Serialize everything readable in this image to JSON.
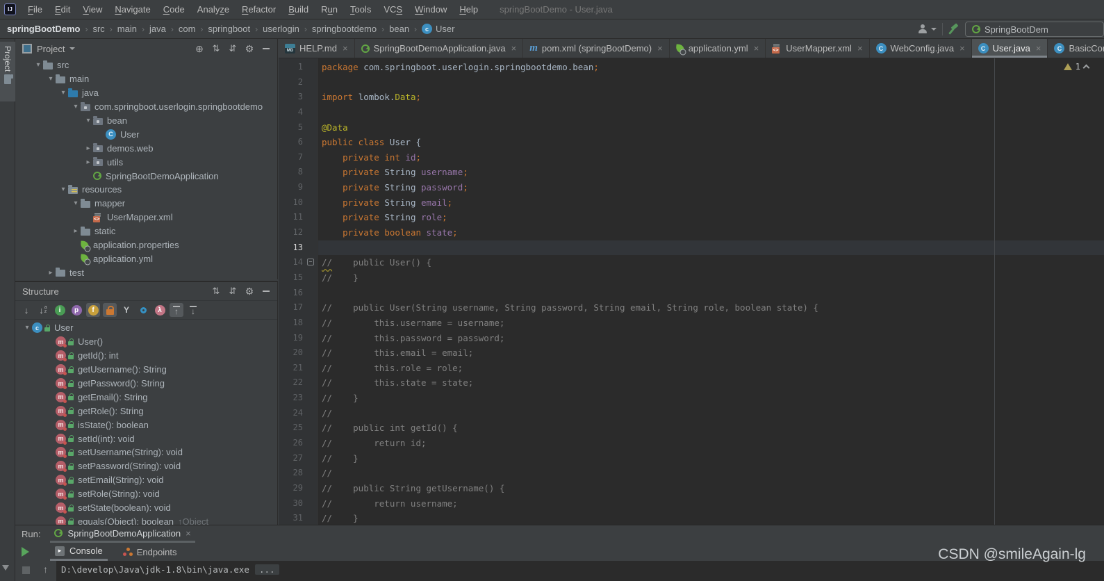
{
  "window": {
    "title": "springBootDemo - User.java",
    "menu": [
      {
        "label": "File",
        "u": 0
      },
      {
        "label": "Edit",
        "u": 0
      },
      {
        "label": "View",
        "u": 0
      },
      {
        "label": "Navigate",
        "u": 0
      },
      {
        "label": "Code",
        "u": 0
      },
      {
        "label": "Analyze",
        "u": 5
      },
      {
        "label": "Refactor",
        "u": 0
      },
      {
        "label": "Build",
        "u": 0
      },
      {
        "label": "Run",
        "u": 1
      },
      {
        "label": "Tools",
        "u": 0
      },
      {
        "label": "VCS",
        "u": 2
      },
      {
        "label": "Window",
        "u": 0
      },
      {
        "label": "Help",
        "u": 0
      }
    ]
  },
  "breadcrumbs": {
    "items": [
      "springBootDemo",
      "src",
      "main",
      "java",
      "com",
      "springboot",
      "userlogin",
      "springbootdemo",
      "bean"
    ],
    "current": {
      "label": "User",
      "icon": "class"
    },
    "run_config": "SpringBootDem"
  },
  "project_panel": {
    "title": "Project",
    "header_icons": [
      "locate",
      "expand-all",
      "collapse-all",
      "settings",
      "hide"
    ],
    "tree": [
      {
        "label": "src",
        "icon": "folder",
        "level": 1,
        "chevron": "open"
      },
      {
        "label": "main",
        "icon": "folder",
        "level": 2,
        "chevron": "open"
      },
      {
        "label": "java",
        "icon": "folder-source",
        "level": 3,
        "chevron": "open"
      },
      {
        "label": "com.springboot.userlogin.springbootdemo",
        "icon": "package",
        "level": 4,
        "chevron": "open"
      },
      {
        "label": "bean",
        "icon": "package",
        "level": 5,
        "chevron": "open"
      },
      {
        "label": "User",
        "icon": "class",
        "letter": "C",
        "level": 6,
        "chevron": "none"
      },
      {
        "label": "demos.web",
        "icon": "package",
        "level": 5,
        "chevron": "closed"
      },
      {
        "label": "utils",
        "icon": "package",
        "level": 5,
        "chevron": "closed"
      },
      {
        "label": "SpringBootDemoApplication",
        "icon": "springboot-class",
        "level": 5,
        "chevron": "none"
      },
      {
        "label": "resources",
        "icon": "folder-resources",
        "level": 3,
        "chevron": "open"
      },
      {
        "label": "mapper",
        "icon": "folder",
        "level": 4,
        "chevron": "open"
      },
      {
        "label": "UserMapper.xml",
        "icon": "xml-file",
        "level": 5,
        "chevron": "none"
      },
      {
        "label": "static",
        "icon": "folder",
        "level": 4,
        "chevron": "closed"
      },
      {
        "label": "application.properties",
        "icon": "spring-file",
        "level": 4,
        "chevron": "none"
      },
      {
        "label": "application.yml",
        "icon": "spring-file",
        "level": 4,
        "chevron": "none"
      },
      {
        "label": "test",
        "icon": "folder",
        "level": 2,
        "chevron": "closed"
      }
    ]
  },
  "structure_panel": {
    "title": "Structure",
    "header_icons": [
      "expand-all",
      "collapse-all",
      "settings",
      "hide"
    ],
    "toolbar": [
      {
        "icon": "sort-visibility",
        "selected": false
      },
      {
        "icon": "sort-alpha",
        "selected": false
      },
      {
        "icon": "inherited",
        "letter": "i",
        "color": "#499C54",
        "selected": false
      },
      {
        "icon": "properties",
        "letter": "p",
        "color": "#8e67ab",
        "selected": false
      },
      {
        "icon": "fields",
        "letter": "f",
        "color": "#c8a03c",
        "selected": true
      },
      {
        "icon": "nonpublic",
        "selected": true
      },
      {
        "icon": "anonymous",
        "letter": "Y",
        "selected": false
      },
      {
        "icon": "ring",
        "selected": false
      },
      {
        "icon": "lambda",
        "letter": "λ",
        "color": "#c27585",
        "selected": false
      },
      {
        "icon": "scroll-to-source",
        "selected": true
      },
      {
        "icon": "scroll-from-source",
        "selected": false
      }
    ],
    "tree": [
      {
        "label": "User",
        "icon": "class",
        "letter": "c",
        "lock": true,
        "level": 0,
        "chevron": "open",
        "suffix": ""
      },
      {
        "label": "User()",
        "icon": "method",
        "letter": "m",
        "lock": true,
        "level": 1,
        "chevron": "none",
        "suffix": ""
      },
      {
        "label": "getId(): int",
        "icon": "method",
        "letter": "m",
        "lock": true,
        "level": 1,
        "chevron": "none",
        "suffix": ""
      },
      {
        "label": "getUsername(): String",
        "icon": "method",
        "letter": "m",
        "lock": true,
        "level": 1,
        "chevron": "none",
        "suffix": ""
      },
      {
        "label": "getPassword(): String",
        "icon": "method",
        "letter": "m",
        "lock": true,
        "level": 1,
        "chevron": "none",
        "suffix": ""
      },
      {
        "label": "getEmail(): String",
        "icon": "method",
        "letter": "m",
        "lock": true,
        "level": 1,
        "chevron": "none",
        "suffix": ""
      },
      {
        "label": "getRole(): String",
        "icon": "method",
        "letter": "m",
        "lock": true,
        "level": 1,
        "chevron": "none",
        "suffix": ""
      },
      {
        "label": "isState(): boolean",
        "icon": "method",
        "letter": "m",
        "lock": true,
        "level": 1,
        "chevron": "none",
        "suffix": ""
      },
      {
        "label": "setId(int): void",
        "icon": "method",
        "letter": "m",
        "lock": true,
        "level": 1,
        "chevron": "none",
        "suffix": ""
      },
      {
        "label": "setUsername(String): void",
        "icon": "method",
        "letter": "m",
        "lock": true,
        "level": 1,
        "chevron": "none",
        "suffix": ""
      },
      {
        "label": "setPassword(String): void",
        "icon": "method",
        "letter": "m",
        "lock": true,
        "level": 1,
        "chevron": "none",
        "suffix": ""
      },
      {
        "label": "setEmail(String): void",
        "icon": "method",
        "letter": "m",
        "lock": true,
        "level": 1,
        "chevron": "none",
        "suffix": ""
      },
      {
        "label": "setRole(String): void",
        "icon": "method",
        "letter": "m",
        "lock": true,
        "level": 1,
        "chevron": "none",
        "suffix": ""
      },
      {
        "label": "setState(boolean): void",
        "icon": "method",
        "letter": "m",
        "lock": true,
        "level": 1,
        "chevron": "none",
        "suffix": ""
      },
      {
        "label": "equals(Object): boolean",
        "icon": "method",
        "letter": "m",
        "lock": true,
        "level": 1,
        "chevron": "none",
        "suffix": "↑Object"
      }
    ]
  },
  "editor": {
    "tabs": [
      {
        "label": "HELP.md",
        "icon": "markdown",
        "letter": "MD",
        "close": true,
        "active": false
      },
      {
        "label": "SpringBootDemoApplication.java",
        "icon": "springboot-class",
        "close": true,
        "active": false
      },
      {
        "label": "pom.xml (springBootDemo)",
        "icon": "maven",
        "letter": "m",
        "close": true,
        "active": false
      },
      {
        "label": "application.yml",
        "icon": "spring-file",
        "close": true,
        "active": false
      },
      {
        "label": "UserMapper.xml",
        "icon": "xml-file",
        "close": true,
        "active": false
      },
      {
        "label": "WebConfig.java",
        "icon": "class",
        "letter": "C",
        "close": true,
        "active": false
      },
      {
        "label": "User.java",
        "icon": "class",
        "letter": "C",
        "close": true,
        "active": true
      },
      {
        "label": "BasicContro",
        "icon": "class",
        "letter": "C",
        "close": false,
        "active": false
      }
    ],
    "warning_count": "1",
    "caret_line": 13,
    "fold_marker_line": 14,
    "lines": [
      {
        "num": "1",
        "tokens": [
          [
            "kw",
            "package "
          ],
          [
            "pl",
            "com.springboot.userlogin.springbootdemo.bean"
          ],
          [
            "sc",
            ";"
          ]
        ]
      },
      {
        "num": "2",
        "tokens": []
      },
      {
        "num": "3",
        "tokens": [
          [
            "kw",
            "import "
          ],
          [
            "pl",
            "lombok."
          ],
          [
            "ann",
            "Data"
          ],
          [
            "sc",
            ";"
          ]
        ]
      },
      {
        "num": "4",
        "tokens": []
      },
      {
        "num": "5",
        "tokens": [
          [
            "ann",
            "@Data"
          ]
        ]
      },
      {
        "num": "6",
        "tokens": [
          [
            "kw",
            "public class "
          ],
          [
            "pl",
            "User {"
          ]
        ]
      },
      {
        "num": "7",
        "tokens": [
          [
            "pl",
            "    "
          ],
          [
            "kw",
            "private int "
          ],
          [
            "fld",
            "id"
          ],
          [
            "sc",
            ";"
          ]
        ]
      },
      {
        "num": "8",
        "tokens": [
          [
            "pl",
            "    "
          ],
          [
            "kw",
            "private "
          ],
          [
            "pl",
            "String "
          ],
          [
            "fld",
            "username"
          ],
          [
            "sc",
            ";"
          ]
        ]
      },
      {
        "num": "9",
        "tokens": [
          [
            "pl",
            "    "
          ],
          [
            "kw",
            "private "
          ],
          [
            "pl",
            "String "
          ],
          [
            "fld",
            "password"
          ],
          [
            "sc",
            ";"
          ]
        ]
      },
      {
        "num": "10",
        "tokens": [
          [
            "pl",
            "    "
          ],
          [
            "kw",
            "private "
          ],
          [
            "pl",
            "String "
          ],
          [
            "fld",
            "email"
          ],
          [
            "sc",
            ";"
          ]
        ]
      },
      {
        "num": "11",
        "tokens": [
          [
            "pl",
            "    "
          ],
          [
            "kw",
            "private "
          ],
          [
            "pl",
            "String "
          ],
          [
            "fld",
            "role"
          ],
          [
            "sc",
            ";"
          ]
        ]
      },
      {
        "num": "12",
        "tokens": [
          [
            "pl",
            "    "
          ],
          [
            "kw",
            "private boolean "
          ],
          [
            "fld",
            "state"
          ],
          [
            "sc",
            ";"
          ]
        ]
      },
      {
        "num": "13",
        "tokens": []
      },
      {
        "num": "14",
        "tokens": [
          [
            "cms",
            "//"
          ],
          [
            "cmt",
            "    public User() {"
          ]
        ]
      },
      {
        "num": "15",
        "tokens": [
          [
            "cmt",
            "//    }"
          ]
        ]
      },
      {
        "num": "16",
        "tokens": []
      },
      {
        "num": "17",
        "tokens": [
          [
            "cmt",
            "//    public User(String username, String password, String email, String role, boolean state) {"
          ]
        ]
      },
      {
        "num": "18",
        "tokens": [
          [
            "cmt",
            "//        this.username = username;"
          ]
        ]
      },
      {
        "num": "19",
        "tokens": [
          [
            "cmt",
            "//        this.password = password;"
          ]
        ]
      },
      {
        "num": "20",
        "tokens": [
          [
            "cmt",
            "//        this.email = email;"
          ]
        ]
      },
      {
        "num": "21",
        "tokens": [
          [
            "cmt",
            "//        this.role = role;"
          ]
        ]
      },
      {
        "num": "22",
        "tokens": [
          [
            "cmt",
            "//        this.state = state;"
          ]
        ]
      },
      {
        "num": "23",
        "tokens": [
          [
            "cmt",
            "//    }"
          ]
        ]
      },
      {
        "num": "24",
        "tokens": [
          [
            "cmt",
            "//"
          ]
        ]
      },
      {
        "num": "25",
        "tokens": [
          [
            "cmt",
            "//    public int getId() {"
          ]
        ]
      },
      {
        "num": "26",
        "tokens": [
          [
            "cmt",
            "//        return id;"
          ]
        ]
      },
      {
        "num": "27",
        "tokens": [
          [
            "cmt",
            "//    }"
          ]
        ]
      },
      {
        "num": "28",
        "tokens": [
          [
            "cmt",
            "//"
          ]
        ]
      },
      {
        "num": "29",
        "tokens": [
          [
            "cmt",
            "//    public String getUsername() {"
          ]
        ]
      },
      {
        "num": "30",
        "tokens": [
          [
            "cmt",
            "//        return username;"
          ]
        ]
      },
      {
        "num": "31",
        "tokens": [
          [
            "cmt",
            "//    }"
          ]
        ]
      }
    ]
  },
  "run_panel": {
    "label": "Run:",
    "config_tab": {
      "label": "SpringBootDemoApplication",
      "icon": "springboot-class",
      "close": "×"
    },
    "tabs": [
      {
        "label": "Console",
        "icon": "console",
        "selected": true
      },
      {
        "label": "Endpoints",
        "icon": "endpoints",
        "selected": false
      }
    ],
    "console_text": "D:\\develop\\Java\\jdk-1.8\\bin\\java.exe",
    "console_ellipsis": "..."
  },
  "stripe": {
    "project_tab": "Project"
  },
  "watermark": "CSDN @smileAgain-lg",
  "colors": {
    "keyword": "#cc7832",
    "plain": "#a9b7c6",
    "annotation": "#bbb529",
    "field": "#9876aa",
    "comment": "#808080",
    "editor_bg": "#2b2b2b",
    "panel_bg": "#3c3f41",
    "spring_green": "#6db33f"
  }
}
